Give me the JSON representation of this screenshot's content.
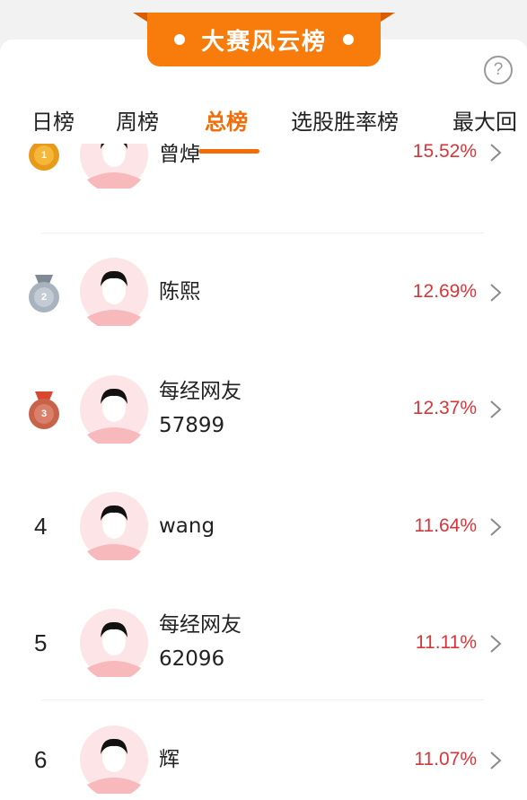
{
  "header": {
    "title": "大赛风云榜"
  },
  "icons": {
    "help": "question-mark-icon",
    "chevron": "chevron-right-icon"
  },
  "colors": {
    "accent": "#f26d0a",
    "ribbon": "#f77c0c",
    "percent": "#d6363a",
    "gold": "#e89a1c",
    "silver": "#a9b3bd",
    "bronze": "#c8634a"
  },
  "tabs": [
    {
      "label": "日榜",
      "active": false
    },
    {
      "label": "周榜",
      "active": false
    },
    {
      "label": "总榜",
      "active": true
    },
    {
      "label": "选股胜率榜",
      "active": false
    },
    {
      "label": "最大回",
      "active": false
    }
  ],
  "rows": [
    {
      "rank": "1",
      "name_lines": [
        "曾焯"
      ],
      "percent": "15.52%",
      "medal": "gold"
    },
    {
      "rank": "2",
      "name_lines": [
        "陈熙"
      ],
      "percent": "12.69%",
      "medal": "silver"
    },
    {
      "rank": "3",
      "name_lines": [
        "每经网友",
        "57899"
      ],
      "percent": "12.37%",
      "medal": "bronze"
    },
    {
      "rank": "4",
      "name_lines": [
        "wang"
      ],
      "percent": "11.64%",
      "medal": ""
    },
    {
      "rank": "5",
      "name_lines": [
        "每经网友",
        "62096"
      ],
      "percent": "11.11%",
      "medal": ""
    },
    {
      "rank": "6",
      "name_lines": [
        "辉"
      ],
      "percent": "11.07%",
      "medal": ""
    }
  ]
}
